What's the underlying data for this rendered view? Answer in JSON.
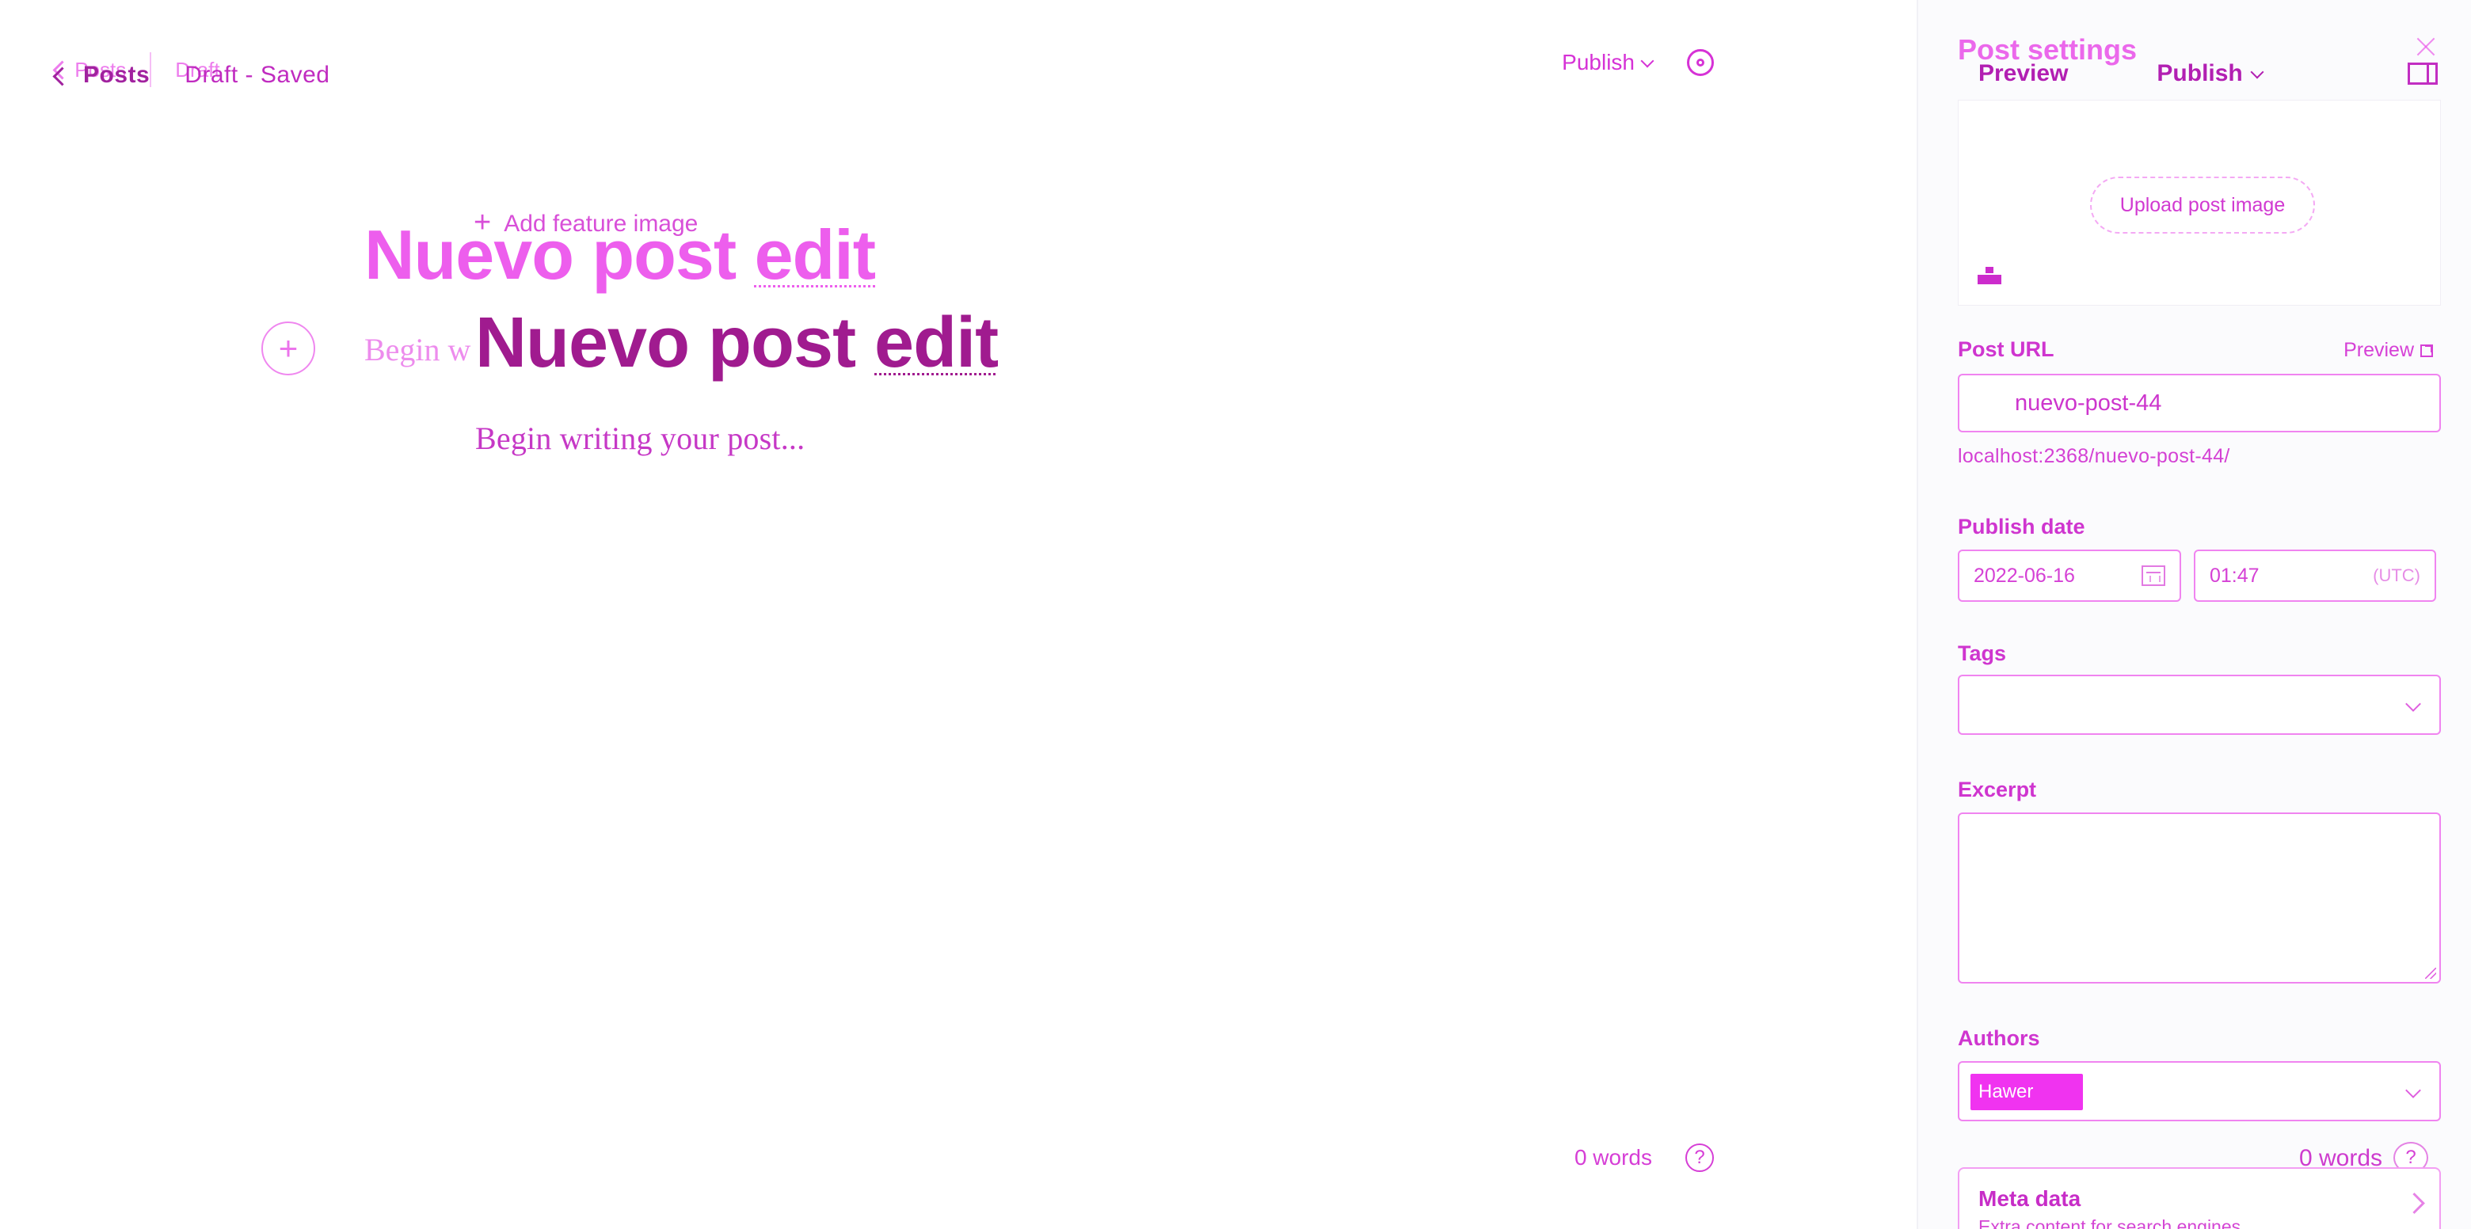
{
  "editor": {
    "topbar": {
      "back_label": "Posts",
      "status_label": "Draft - Saved",
      "ghost_back_label": "Posts",
      "ghost_status_label": "Draft"
    },
    "toolbar": {
      "publish_label": "Publish"
    },
    "feature_image_label": "Add feature image",
    "title": {
      "prefix": "Nuevo post ",
      "underlined": "edit"
    },
    "body_placeholder": "Begin writing your post...",
    "ghost_body_placeholder": "Begin w",
    "word_count": "0 words",
    "help_label": "?"
  },
  "settings": {
    "title": "Post settings",
    "preview_label": "Preview",
    "publish_label": "Publish",
    "upload_label": "Upload post image",
    "post_url": {
      "label": "Post URL",
      "preview_label": "Preview",
      "value": "nuevo-post-44",
      "full_url": "localhost:2368/nuevo-post-44/"
    },
    "publish_date": {
      "label": "Publish date",
      "date": "2022-06-16",
      "time": "01:47",
      "timezone": "(UTC)"
    },
    "tags_label": "Tags",
    "excerpt_label": "Excerpt",
    "authors": {
      "label": "Authors",
      "selected": "Hawer"
    },
    "ghost_word_count": "0 words",
    "ghost_help": "?",
    "meta_data": {
      "title": "Meta data",
      "description": "Extra content for search engines"
    }
  }
}
